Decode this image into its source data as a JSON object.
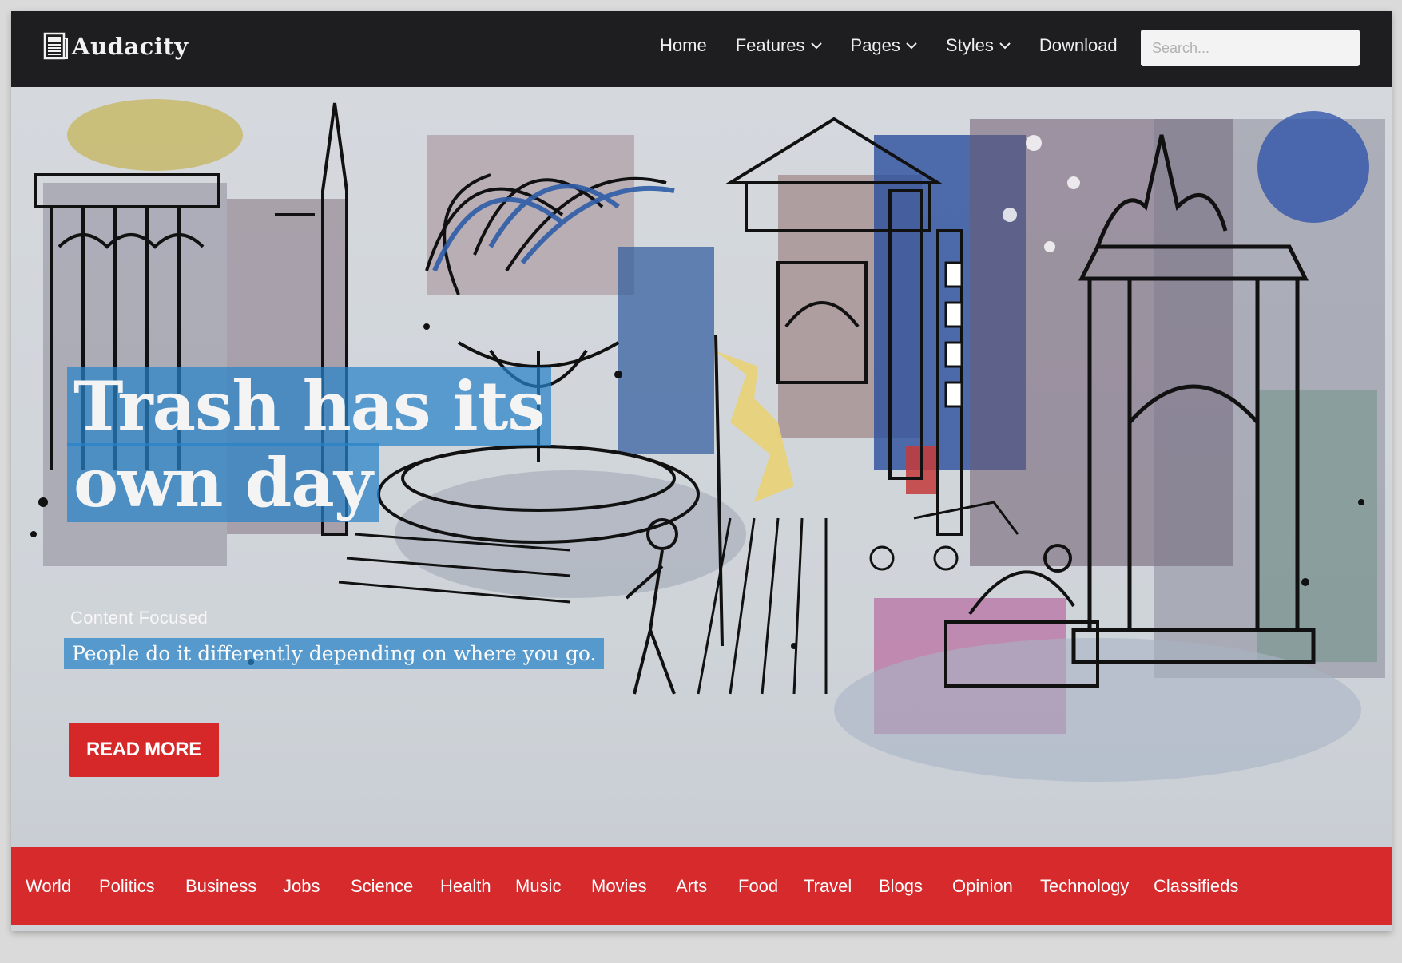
{
  "brand": {
    "name": "Audacity",
    "icon": "newspaper-icon"
  },
  "nav": {
    "items": [
      {
        "label": "Home",
        "dropdown": false
      },
      {
        "label": "Features",
        "dropdown": true
      },
      {
        "label": "Pages",
        "dropdown": true
      },
      {
        "label": "Styles",
        "dropdown": true
      },
      {
        "label": "Download",
        "dropdown": false
      }
    ],
    "search_placeholder": "Search..."
  },
  "hero": {
    "headline_line1": "Trash has its",
    "headline_line2": "own day",
    "kicker": "Content Focused",
    "subline": "People do it differently depending on where you go.",
    "cta_label": "READ MORE"
  },
  "categories": [
    "World",
    "Politics",
    "Business",
    "Jobs",
    "Science",
    "Health",
    "Music",
    "Movies",
    "Arts",
    "Food",
    "Travel",
    "Blogs",
    "Opinion",
    "Technology",
    "Classifieds"
  ],
  "colors": {
    "navbar": "#1e1e20",
    "accent_red": "#d62a2c",
    "highlight_blue": "#2882c8",
    "text_light": "#f4f4f4"
  }
}
